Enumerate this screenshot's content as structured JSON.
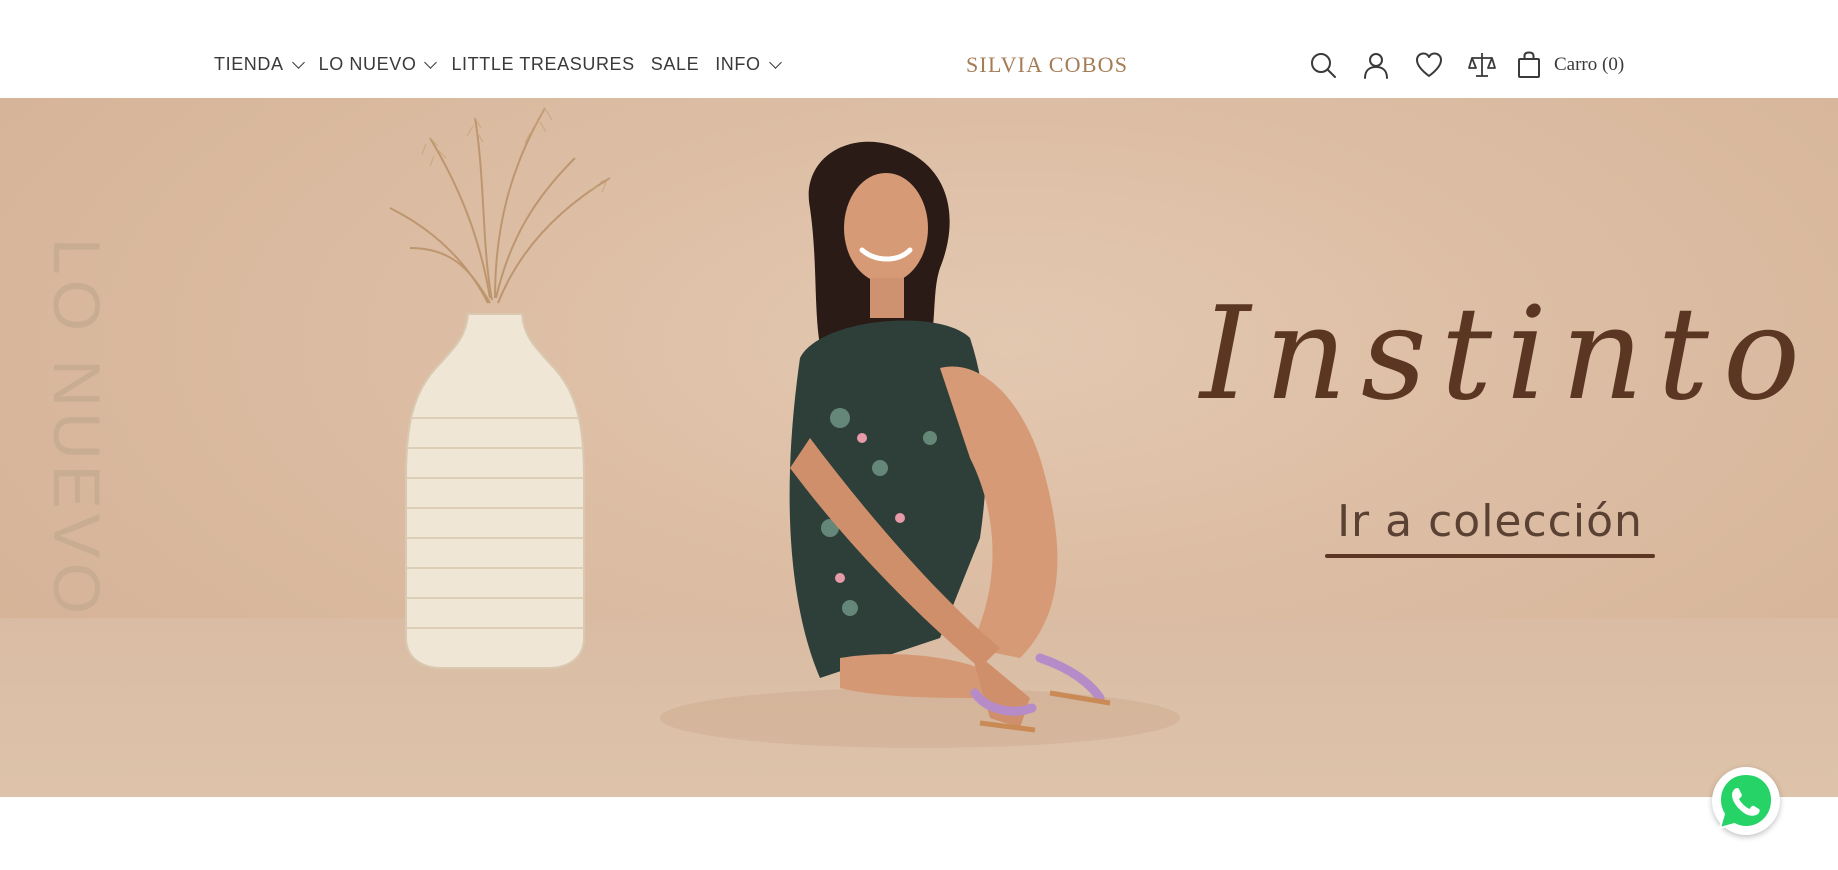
{
  "header": {
    "nav": [
      {
        "label": "TIENDA",
        "has_dropdown": true
      },
      {
        "label": "LO NUEVO",
        "has_dropdown": true
      },
      {
        "label": "LITTLE TREASURES",
        "has_dropdown": false
      },
      {
        "label": "SALE",
        "has_dropdown": false
      },
      {
        "label": "INFO",
        "has_dropdown": true
      }
    ],
    "logo": "SILVIA COBOS",
    "tools": {
      "search_icon": "search-icon",
      "account_icon": "user-icon",
      "wishlist_icon": "heart-icon",
      "compare_icon": "scale-icon",
      "cart_icon": "shopping-bag-icon",
      "cart_label": "Carro (0)"
    }
  },
  "hero": {
    "vertical_label": "LO NUEVO",
    "title": "Instinto",
    "cta_label": "Ir a colección",
    "colors": {
      "background": "#dcbda3",
      "title": "#5b3622",
      "vertical_label": "#c9ad92"
    }
  },
  "floating": {
    "whatsapp_icon": "whatsapp-icon",
    "whatsapp_color": "#25d366"
  },
  "colors": {
    "logo": "#a47c55",
    "nav_text": "#3a3a3a"
  }
}
